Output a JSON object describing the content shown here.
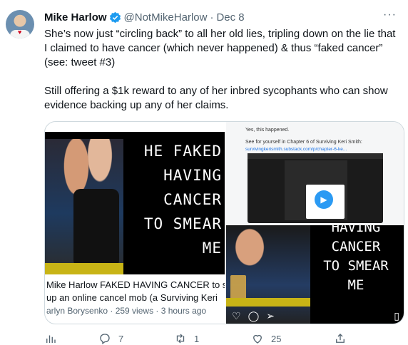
{
  "tweet": {
    "display_name": "Mike Harlow",
    "handle": "@NotMikeHarlow",
    "separator": "·",
    "date": "Dec 8",
    "more": "···",
    "paragraphs": [
      "She’s now just “circling back” to all her old lies, tripling down on the lie that I claimed to have cancer (which never happened) & thus “faked cancer” (see: tweet #3)",
      "Still offering a $1k reward to any of her inbred sycophants who can show evidence backing up any of her claims."
    ]
  },
  "media": {
    "youtube_card": {
      "thumbnail_text": "HE FAKED\nHAVING\nCANCER\nTO SMEAR\nME",
      "title_line1": "Mike Harlow FAKED HAVING CANCER to s",
      "title_line2": "up an online cancel mob (a Surviving Keri",
      "meta": "arlyn Borysenko · 259 views · 3 hours ago"
    },
    "screenshot": {
      "line1": "Yes, this happened.",
      "line2": "See for yourself in Chapter 6 of Surviving Keri Smith:",
      "link": "survivingkerismith.substack.com/p/chapter-6-ke..."
    },
    "video2": {
      "overlay_text": "HAVING\nCANCER\nTO SMEAR\nME"
    }
  },
  "actions": {
    "analytics_count": "",
    "reply_count": "7",
    "retweet_count": "1",
    "like_count": "25"
  },
  "colors": {
    "text_primary": "#0f1419",
    "text_secondary": "#536471",
    "verified": "#1d9bf0",
    "border": "#cfd9de"
  }
}
